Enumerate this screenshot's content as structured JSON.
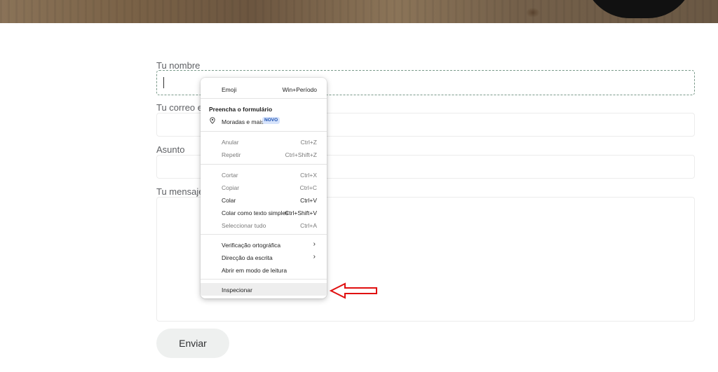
{
  "form": {
    "name_label": "Tu nombre",
    "email_label": "Tu correo ele",
    "subject_label": "Asunto",
    "message_label": "Tu mensaje",
    "submit_label": "Enviar"
  },
  "context_menu": {
    "emoji": {
      "label": "Emoji",
      "shortcut": "Win+Período"
    },
    "autofill_section": "Preencha o formulário",
    "addresses": {
      "label": "Moradas e mais",
      "badge": "NOVO"
    },
    "undo": {
      "label": "Anular",
      "shortcut": "Ctrl+Z"
    },
    "redo": {
      "label": "Repetir",
      "shortcut": "Ctrl+Shift+Z"
    },
    "cut": {
      "label": "Cortar",
      "shortcut": "Ctrl+X"
    },
    "copy": {
      "label": "Copiar",
      "shortcut": "Ctrl+C"
    },
    "paste": {
      "label": "Colar",
      "shortcut": "Ctrl+V"
    },
    "paste_plain": {
      "label": "Colar como texto simples",
      "shortcut": "Ctrl+Shift+V"
    },
    "select_all": {
      "label": "Seleccionar tudo",
      "shortcut": "Ctrl+A"
    },
    "spellcheck": {
      "label": "Verificação ortográfica"
    },
    "writing_direction": {
      "label": "Direcção da escrita"
    },
    "reader_mode": {
      "label": "Abrir em modo de leitura"
    },
    "inspect": {
      "label": "Inspecionar"
    }
  },
  "colors": {
    "annotation_arrow": "#e01010",
    "badge_bg": "#d6e3fb",
    "badge_text": "#1a4fb0"
  }
}
